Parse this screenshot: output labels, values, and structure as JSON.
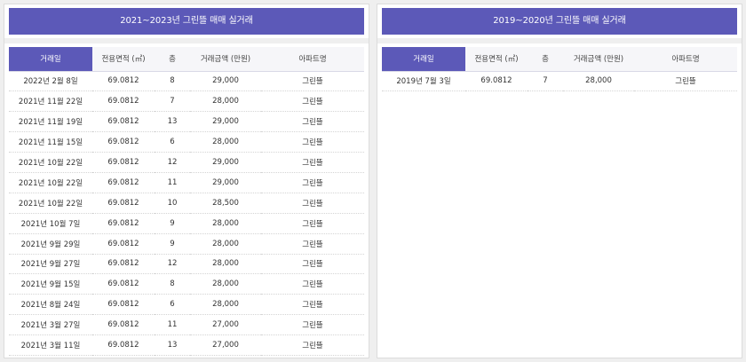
{
  "left_panel": {
    "title": "2021~2023년 그린뜰 매매 실거래",
    "columns": [
      "거래일",
      "전용면적 (㎡)",
      "층",
      "거래금액 (만원)",
      "아파트명"
    ],
    "rows": [
      [
        "2022년 2월 8일",
        "69.0812",
        "8",
        "29,000",
        "그린뜰"
      ],
      [
        "2021년 11월 22일",
        "69.0812",
        "7",
        "28,000",
        "그린뜰"
      ],
      [
        "2021년 11월 19일",
        "69.0812",
        "13",
        "29,000",
        "그린뜰"
      ],
      [
        "2021년 11월 15일",
        "69.0812",
        "6",
        "28,000",
        "그린뜰"
      ],
      [
        "2021년 10월 22일",
        "69.0812",
        "12",
        "29,000",
        "그린뜰"
      ],
      [
        "2021년 10월 22일",
        "69.0812",
        "11",
        "29,000",
        "그린뜰"
      ],
      [
        "2021년 10월 22일",
        "69.0812",
        "10",
        "28,500",
        "그린뜰"
      ],
      [
        "2021년 10월 7일",
        "69.0812",
        "9",
        "28,000",
        "그린뜰"
      ],
      [
        "2021년 9월 29일",
        "69.0812",
        "9",
        "28,000",
        "그린뜰"
      ],
      [
        "2021년 9월 27일",
        "69.0812",
        "12",
        "28,000",
        "그린뜰"
      ],
      [
        "2021년 9월 15일",
        "69.0812",
        "8",
        "28,000",
        "그린뜰"
      ],
      [
        "2021년 8월 24일",
        "69.0812",
        "6",
        "28,000",
        "그린뜰"
      ],
      [
        "2021년 3월 27일",
        "69.0812",
        "11",
        "27,000",
        "그린뜰"
      ],
      [
        "2021년 3월 11일",
        "69.0812",
        "13",
        "27,000",
        "그린뜰"
      ]
    ]
  },
  "right_panel": {
    "title": "2019~2020년 그린뜰 매매 실거래",
    "columns": [
      "거래일",
      "전용면적 (㎡)",
      "층",
      "거래금액 (만원)",
      "아파트명"
    ],
    "rows": [
      [
        "2019년 7월 3일",
        "69.0812",
        "7",
        "28,000",
        "그린뜰"
      ]
    ]
  },
  "colors": {
    "accent": "#5c59b8",
    "page_background": "#efefef",
    "panel_background": "#ffffff"
  }
}
